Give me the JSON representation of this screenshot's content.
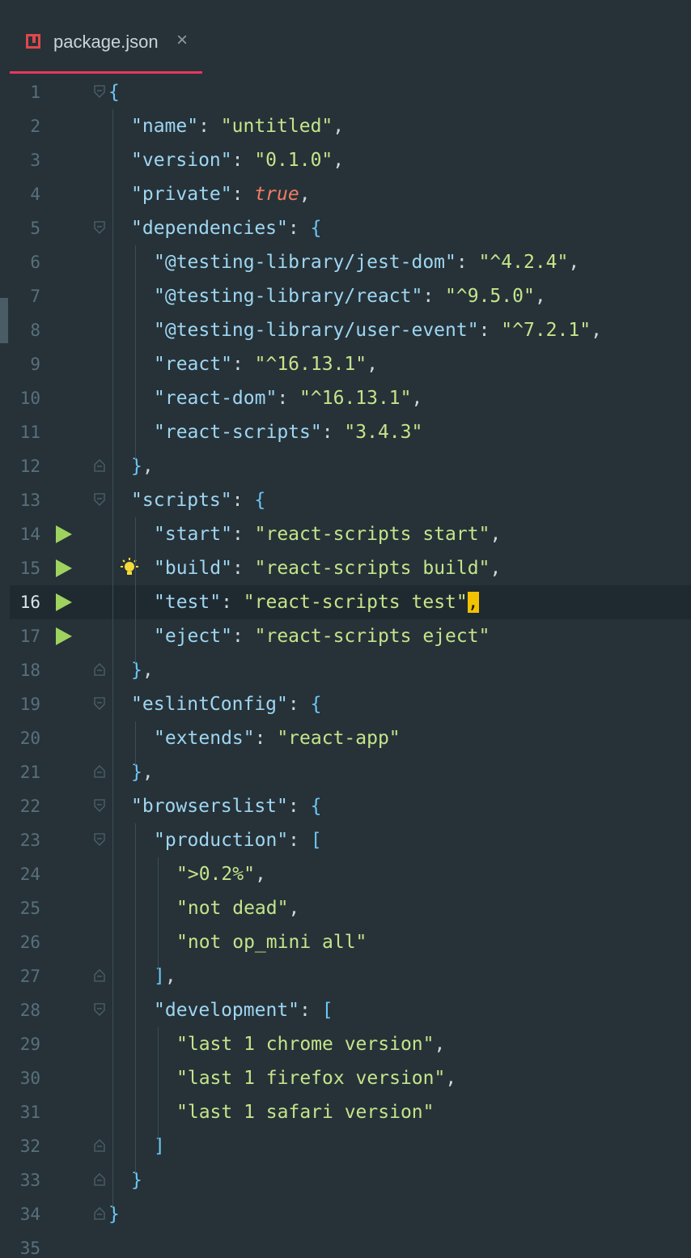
{
  "tab": {
    "title": "package.json",
    "close_icon": "×"
  },
  "colors": {
    "background": "#263238",
    "tab_underline": "#e8375f",
    "run_icon": "#9ed35f",
    "bulb_icon": "#f5d93b",
    "cursor": "#f2c200"
  },
  "editor": {
    "current_line": 16,
    "lines": [
      {
        "n": "1",
        "indent": 0,
        "tokens": [
          {
            "t": "{",
            "c": "b"
          }
        ],
        "fold": "open"
      },
      {
        "n": "2",
        "indent": 1,
        "tokens": [
          {
            "t": "\"name\"",
            "c": "k"
          },
          {
            "t": ": ",
            "c": "p"
          },
          {
            "t": "\"untitled\"",
            "c": "s"
          },
          {
            "t": ",",
            "c": "p"
          }
        ]
      },
      {
        "n": "3",
        "indent": 1,
        "tokens": [
          {
            "t": "\"version\"",
            "c": "k"
          },
          {
            "t": ": ",
            "c": "p"
          },
          {
            "t": "\"0.1.0\"",
            "c": "s"
          },
          {
            "t": ",",
            "c": "p"
          }
        ]
      },
      {
        "n": "4",
        "indent": 1,
        "tokens": [
          {
            "t": "\"private\"",
            "c": "k"
          },
          {
            "t": ": ",
            "c": "p"
          },
          {
            "t": "true",
            "c": "bool"
          },
          {
            "t": ",",
            "c": "p"
          }
        ]
      },
      {
        "n": "5",
        "indent": 1,
        "tokens": [
          {
            "t": "\"dependencies\"",
            "c": "k"
          },
          {
            "t": ": ",
            "c": "p"
          },
          {
            "t": "{",
            "c": "b"
          }
        ],
        "fold": "open"
      },
      {
        "n": "6",
        "indent": 2,
        "tokens": [
          {
            "t": "\"@testing-library/jest-dom\"",
            "c": "k"
          },
          {
            "t": ": ",
            "c": "p"
          },
          {
            "t": "\"^4.2.4\"",
            "c": "s"
          },
          {
            "t": ",",
            "c": "p"
          }
        ]
      },
      {
        "n": "7",
        "indent": 2,
        "tokens": [
          {
            "t": "\"@testing-library/react\"",
            "c": "k"
          },
          {
            "t": ": ",
            "c": "p"
          },
          {
            "t": "\"^9.5.0\"",
            "c": "s"
          },
          {
            "t": ",",
            "c": "p"
          }
        ]
      },
      {
        "n": "8",
        "indent": 2,
        "tokens": [
          {
            "t": "\"@testing-library/user-event\"",
            "c": "k"
          },
          {
            "t": ": ",
            "c": "p"
          },
          {
            "t": "\"^7.2.1\"",
            "c": "s"
          },
          {
            "t": ",",
            "c": "p"
          }
        ]
      },
      {
        "n": "9",
        "indent": 2,
        "tokens": [
          {
            "t": "\"react\"",
            "c": "k"
          },
          {
            "t": ": ",
            "c": "p"
          },
          {
            "t": "\"^16.13.1\"",
            "c": "s"
          },
          {
            "t": ",",
            "c": "p"
          }
        ]
      },
      {
        "n": "10",
        "indent": 2,
        "tokens": [
          {
            "t": "\"react-dom\"",
            "c": "k"
          },
          {
            "t": ": ",
            "c": "p"
          },
          {
            "t": "\"^16.13.1\"",
            "c": "s"
          },
          {
            "t": ",",
            "c": "p"
          }
        ]
      },
      {
        "n": "11",
        "indent": 2,
        "tokens": [
          {
            "t": "\"react-scripts\"",
            "c": "k"
          },
          {
            "t": ": ",
            "c": "p"
          },
          {
            "t": "\"3.4.3\"",
            "c": "s"
          }
        ]
      },
      {
        "n": "12",
        "indent": 1,
        "tokens": [
          {
            "t": "}",
            "c": "b"
          },
          {
            "t": ",",
            "c": "p"
          }
        ],
        "fold": "close"
      },
      {
        "n": "13",
        "indent": 1,
        "tokens": [
          {
            "t": "\"scripts\"",
            "c": "k"
          },
          {
            "t": ": ",
            "c": "p"
          },
          {
            "t": "{",
            "c": "b"
          }
        ],
        "fold": "open"
      },
      {
        "n": "14",
        "indent": 2,
        "tokens": [
          {
            "t": "\"start\"",
            "c": "k"
          },
          {
            "t": ": ",
            "c": "p"
          },
          {
            "t": "\"react-scripts start\"",
            "c": "s"
          },
          {
            "t": ",",
            "c": "p"
          }
        ],
        "run": true
      },
      {
        "n": "15",
        "indent": 2,
        "tokens": [
          {
            "t": "\"build\"",
            "c": "k"
          },
          {
            "t": ": ",
            "c": "p"
          },
          {
            "t": "\"react-scripts build\"",
            "c": "s"
          },
          {
            "t": ",",
            "c": "p"
          }
        ],
        "run": true,
        "bulb": true
      },
      {
        "n": "16",
        "indent": 2,
        "tokens": [
          {
            "t": "\"test\"",
            "c": "k"
          },
          {
            "t": ": ",
            "c": "p"
          },
          {
            "t": "\"react-scripts test\"",
            "c": "s"
          },
          {
            "t": ",",
            "c": "cursor"
          }
        ],
        "run": true
      },
      {
        "n": "17",
        "indent": 2,
        "tokens": [
          {
            "t": "\"eject\"",
            "c": "k"
          },
          {
            "t": ": ",
            "c": "p"
          },
          {
            "t": "\"react-scripts eject\"",
            "c": "s"
          }
        ],
        "run": true
      },
      {
        "n": "18",
        "indent": 1,
        "tokens": [
          {
            "t": "}",
            "c": "b"
          },
          {
            "t": ",",
            "c": "p"
          }
        ],
        "fold": "close"
      },
      {
        "n": "19",
        "indent": 1,
        "tokens": [
          {
            "t": "\"eslintConfig\"",
            "c": "k"
          },
          {
            "t": ": ",
            "c": "p"
          },
          {
            "t": "{",
            "c": "b"
          }
        ],
        "fold": "open"
      },
      {
        "n": "20",
        "indent": 2,
        "tokens": [
          {
            "t": "\"extends\"",
            "c": "k"
          },
          {
            "t": ": ",
            "c": "p"
          },
          {
            "t": "\"react-app\"",
            "c": "s"
          }
        ]
      },
      {
        "n": "21",
        "indent": 1,
        "tokens": [
          {
            "t": "}",
            "c": "b"
          },
          {
            "t": ",",
            "c": "p"
          }
        ],
        "fold": "close"
      },
      {
        "n": "22",
        "indent": 1,
        "tokens": [
          {
            "t": "\"browserslist\"",
            "c": "k"
          },
          {
            "t": ": ",
            "c": "p"
          },
          {
            "t": "{",
            "c": "b"
          }
        ],
        "fold": "open"
      },
      {
        "n": "23",
        "indent": 2,
        "tokens": [
          {
            "t": "\"production\"",
            "c": "k"
          },
          {
            "t": ": ",
            "c": "p"
          },
          {
            "t": "[",
            "c": "b"
          }
        ],
        "fold": "open"
      },
      {
        "n": "24",
        "indent": 3,
        "tokens": [
          {
            "t": "\">0.2%\"",
            "c": "s"
          },
          {
            "t": ",",
            "c": "p"
          }
        ]
      },
      {
        "n": "25",
        "indent": 3,
        "tokens": [
          {
            "t": "\"not dead\"",
            "c": "s"
          },
          {
            "t": ",",
            "c": "p"
          }
        ]
      },
      {
        "n": "26",
        "indent": 3,
        "tokens": [
          {
            "t": "\"not op_mini all\"",
            "c": "s"
          }
        ]
      },
      {
        "n": "27",
        "indent": 2,
        "tokens": [
          {
            "t": "]",
            "c": "b"
          },
          {
            "t": ",",
            "c": "p"
          }
        ],
        "fold": "close"
      },
      {
        "n": "28",
        "indent": 2,
        "tokens": [
          {
            "t": "\"development\"",
            "c": "k"
          },
          {
            "t": ": ",
            "c": "p"
          },
          {
            "t": "[",
            "c": "b"
          }
        ],
        "fold": "open"
      },
      {
        "n": "29",
        "indent": 3,
        "tokens": [
          {
            "t": "\"last 1 chrome version\"",
            "c": "s"
          },
          {
            "t": ",",
            "c": "p"
          }
        ]
      },
      {
        "n": "30",
        "indent": 3,
        "tokens": [
          {
            "t": "\"last 1 firefox version\"",
            "c": "s"
          },
          {
            "t": ",",
            "c": "p"
          }
        ]
      },
      {
        "n": "31",
        "indent": 3,
        "tokens": [
          {
            "t": "\"last 1 safari version\"",
            "c": "s"
          }
        ]
      },
      {
        "n": "32",
        "indent": 2,
        "tokens": [
          {
            "t": "]",
            "c": "b"
          }
        ],
        "fold": "close"
      },
      {
        "n": "33",
        "indent": 1,
        "tokens": [
          {
            "t": "}",
            "c": "b"
          }
        ],
        "fold": "close"
      },
      {
        "n": "34",
        "indent": 0,
        "tokens": [
          {
            "t": "}",
            "c": "b"
          }
        ],
        "fold": "close"
      },
      {
        "n": "35",
        "indent": 0,
        "tokens": []
      }
    ]
  }
}
